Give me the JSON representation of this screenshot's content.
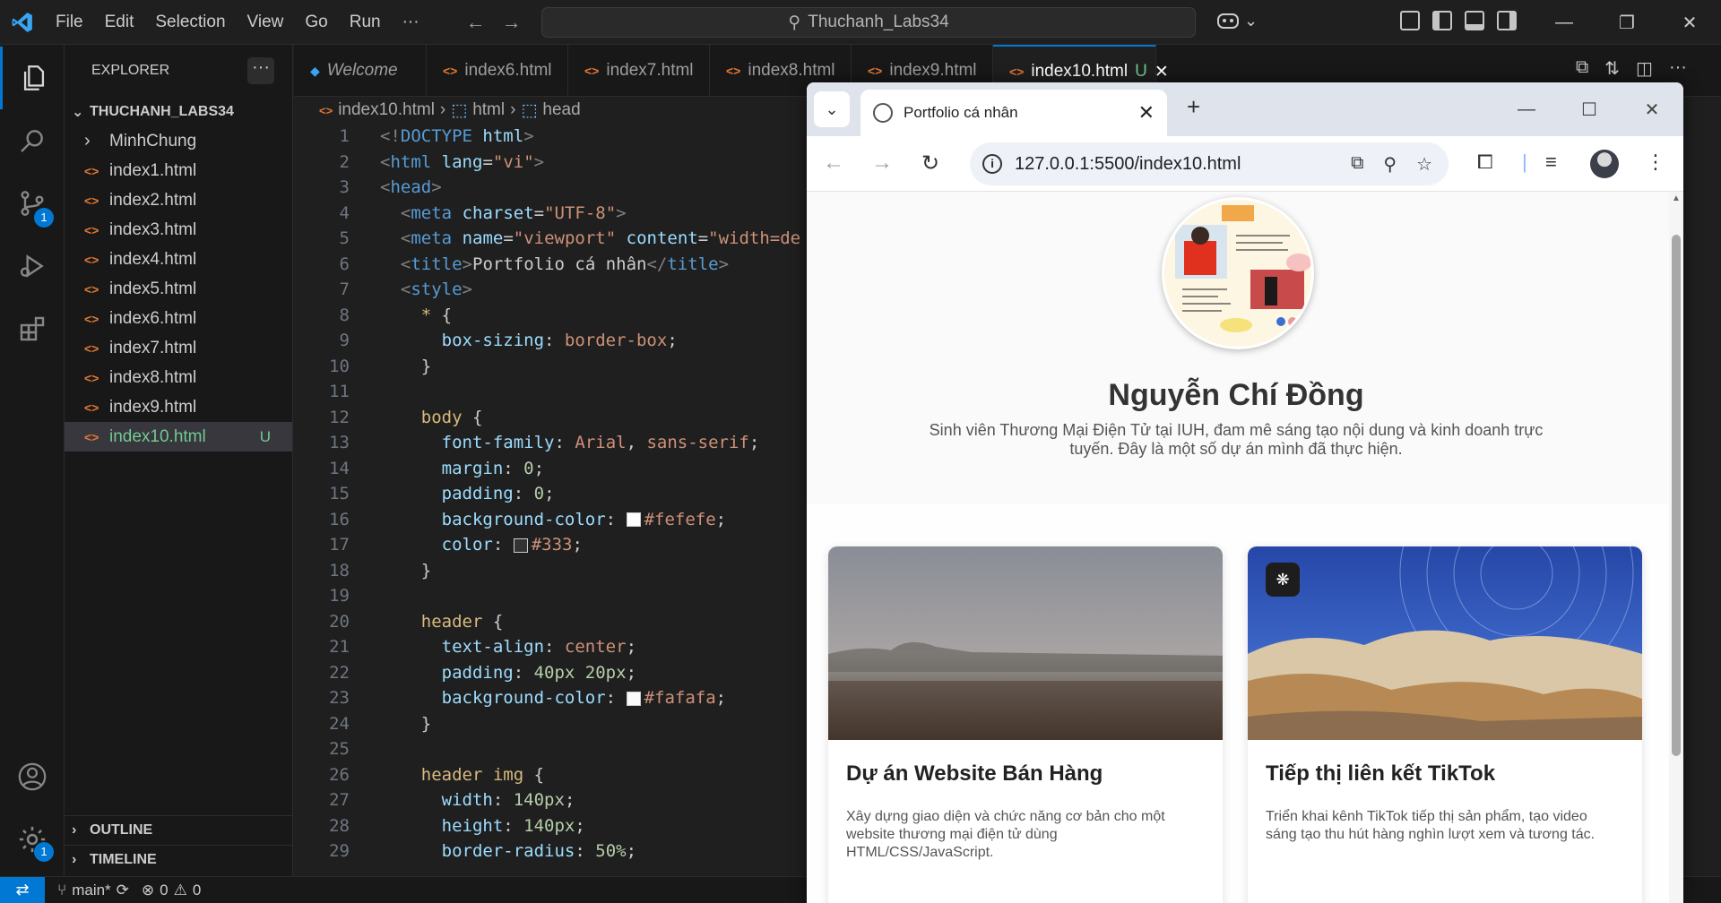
{
  "menu": [
    "File",
    "Edit",
    "Selection",
    "View",
    "Go",
    "Run",
    "···"
  ],
  "command_center": "Thuchanh_Labs34",
  "explorer": {
    "title": "EXPLORER",
    "folder": "THUCHANH_LABS34",
    "items": [
      {
        "label": "MinhChung",
        "type": "folder",
        "icon": "chevron-right-icon"
      },
      {
        "label": "index1.html",
        "type": "html"
      },
      {
        "label": "index2.html",
        "type": "html"
      },
      {
        "label": "index3.html",
        "type": "html"
      },
      {
        "label": "index4.html",
        "type": "html"
      },
      {
        "label": "index5.html",
        "type": "html"
      },
      {
        "label": "index6.html",
        "type": "html"
      },
      {
        "label": "index7.html",
        "type": "html"
      },
      {
        "label": "index8.html",
        "type": "html"
      },
      {
        "label": "index9.html",
        "type": "html"
      },
      {
        "label": "index10.html",
        "type": "html",
        "status": "U",
        "selected": true
      }
    ],
    "outline": "OUTLINE",
    "timeline": "TIMELINE"
  },
  "activity_badges": {
    "source_control": "1",
    "settings": "1"
  },
  "tabs": [
    {
      "label": "Welcome",
      "kind": "welcome"
    },
    {
      "label": "index6.html"
    },
    {
      "label": "index7.html"
    },
    {
      "label": "index8.html"
    },
    {
      "label": "index9.html"
    },
    {
      "label": "index10.html",
      "status": "U",
      "active": true
    }
  ],
  "breadcrumb": [
    "index10.html",
    "html",
    "head"
  ],
  "code_lines": [
    {
      "n": "1",
      "tokens": [
        [
          "tag",
          "<!"
        ],
        [
          "name",
          "DOCTYPE"
        ],
        [
          "txt",
          " "
        ],
        [
          "attr",
          "html"
        ],
        [
          "tag",
          ">"
        ]
      ]
    },
    {
      "n": "2",
      "tokens": [
        [
          "tag",
          "<"
        ],
        [
          "name",
          "html"
        ],
        [
          "txt",
          " "
        ],
        [
          "attr",
          "lang"
        ],
        [
          "txt",
          "="
        ],
        [
          "str",
          "\"vi\""
        ],
        [
          "tag",
          ">"
        ]
      ]
    },
    {
      "n": "3",
      "tokens": [
        [
          "tag",
          "<"
        ],
        [
          "name",
          "head"
        ],
        [
          "tag",
          ">"
        ]
      ]
    },
    {
      "n": "4",
      "tokens": [
        [
          "txt",
          "  "
        ],
        [
          "tag",
          "<"
        ],
        [
          "name",
          "meta"
        ],
        [
          "txt",
          " "
        ],
        [
          "attr",
          "charset"
        ],
        [
          "txt",
          "="
        ],
        [
          "str",
          "\"UTF-8\""
        ],
        [
          "tag",
          ">"
        ]
      ]
    },
    {
      "n": "5",
      "tokens": [
        [
          "txt",
          "  "
        ],
        [
          "tag",
          "<"
        ],
        [
          "name",
          "meta"
        ],
        [
          "txt",
          " "
        ],
        [
          "attr",
          "name"
        ],
        [
          "txt",
          "="
        ],
        [
          "str",
          "\"viewport\""
        ],
        [
          "txt",
          " "
        ],
        [
          "attr",
          "content"
        ],
        [
          "txt",
          "="
        ],
        [
          "str",
          "\"width=de"
        ]
      ]
    },
    {
      "n": "6",
      "tokens": [
        [
          "txt",
          "  "
        ],
        [
          "tag",
          "<"
        ],
        [
          "name",
          "title"
        ],
        [
          "tag",
          ">"
        ],
        [
          "txt",
          "Portfolio cá nhân"
        ],
        [
          "tag",
          "</"
        ],
        [
          "name",
          "title"
        ],
        [
          "tag",
          ">"
        ]
      ]
    },
    {
      "n": "7",
      "tokens": [
        [
          "txt",
          "  "
        ],
        [
          "tag",
          "<"
        ],
        [
          "name",
          "style"
        ],
        [
          "tag",
          ">"
        ]
      ]
    },
    {
      "n": "8",
      "tokens": [
        [
          "txt",
          "    "
        ],
        [
          "sel",
          "*"
        ],
        [
          "txt",
          " {"
        ]
      ]
    },
    {
      "n": "9",
      "tokens": [
        [
          "txt",
          "      "
        ],
        [
          "prop",
          "box-sizing"
        ],
        [
          "txt",
          ": "
        ],
        [
          "val",
          "border-box"
        ],
        [
          "txt",
          ";"
        ]
      ]
    },
    {
      "n": "10",
      "tokens": [
        [
          "txt",
          "    }"
        ]
      ]
    },
    {
      "n": "11",
      "tokens": [
        [
          "txt",
          ""
        ]
      ]
    },
    {
      "n": "12",
      "tokens": [
        [
          "txt",
          "    "
        ],
        [
          "sel",
          "body"
        ],
        [
          "txt",
          " {"
        ]
      ]
    },
    {
      "n": "13",
      "tokens": [
        [
          "txt",
          "      "
        ],
        [
          "prop",
          "font-family"
        ],
        [
          "txt",
          ": "
        ],
        [
          "val",
          "Arial"
        ],
        [
          "txt",
          ", "
        ],
        [
          "val",
          "sans-serif"
        ],
        [
          "txt",
          ";"
        ]
      ]
    },
    {
      "n": "14",
      "tokens": [
        [
          "txt",
          "      "
        ],
        [
          "prop",
          "margin"
        ],
        [
          "txt",
          ": "
        ],
        [
          "num",
          "0"
        ],
        [
          "txt",
          ";"
        ]
      ]
    },
    {
      "n": "15",
      "tokens": [
        [
          "txt",
          "      "
        ],
        [
          "prop",
          "padding"
        ],
        [
          "txt",
          ": "
        ],
        [
          "num",
          "0"
        ],
        [
          "txt",
          ";"
        ]
      ]
    },
    {
      "n": "16",
      "tokens": [
        [
          "txt",
          "      "
        ],
        [
          "prop",
          "background-color"
        ],
        [
          "txt",
          ": "
        ],
        [
          "swatch",
          "#fefefe"
        ],
        [
          "val",
          "#fefefe"
        ],
        [
          "txt",
          ";"
        ]
      ]
    },
    {
      "n": "17",
      "tokens": [
        [
          "txt",
          "      "
        ],
        [
          "prop",
          "color"
        ],
        [
          "txt",
          ": "
        ],
        [
          "swatch",
          "#333333"
        ],
        [
          "val",
          "#333"
        ],
        [
          "txt",
          ";"
        ]
      ]
    },
    {
      "n": "18",
      "tokens": [
        [
          "txt",
          "    }"
        ]
      ]
    },
    {
      "n": "19",
      "tokens": [
        [
          "txt",
          ""
        ]
      ]
    },
    {
      "n": "20",
      "tokens": [
        [
          "txt",
          "    "
        ],
        [
          "sel",
          "header"
        ],
        [
          "txt",
          " {"
        ]
      ]
    },
    {
      "n": "21",
      "tokens": [
        [
          "txt",
          "      "
        ],
        [
          "prop",
          "text-align"
        ],
        [
          "txt",
          ": "
        ],
        [
          "val",
          "center"
        ],
        [
          "txt",
          ";"
        ]
      ]
    },
    {
      "n": "22",
      "tokens": [
        [
          "txt",
          "      "
        ],
        [
          "prop",
          "padding"
        ],
        [
          "txt",
          ": "
        ],
        [
          "num",
          "40px 20px"
        ],
        [
          "txt",
          ";"
        ]
      ]
    },
    {
      "n": "23",
      "tokens": [
        [
          "txt",
          "      "
        ],
        [
          "prop",
          "background-color"
        ],
        [
          "txt",
          ": "
        ],
        [
          "swatch",
          "#fafafa"
        ],
        [
          "val",
          "#fafafa"
        ],
        [
          "txt",
          ";"
        ]
      ]
    },
    {
      "n": "24",
      "tokens": [
        [
          "txt",
          "    }"
        ]
      ]
    },
    {
      "n": "25",
      "tokens": [
        [
          "txt",
          ""
        ]
      ]
    },
    {
      "n": "26",
      "tokens": [
        [
          "txt",
          "    "
        ],
        [
          "sel",
          "header img"
        ],
        [
          "txt",
          " {"
        ]
      ]
    },
    {
      "n": "27",
      "tokens": [
        [
          "txt",
          "      "
        ],
        [
          "prop",
          "width"
        ],
        [
          "txt",
          ": "
        ],
        [
          "num",
          "140px"
        ],
        [
          "txt",
          ";"
        ]
      ]
    },
    {
      "n": "28",
      "tokens": [
        [
          "txt",
          "      "
        ],
        [
          "prop",
          "height"
        ],
        [
          "txt",
          ": "
        ],
        [
          "num",
          "140px"
        ],
        [
          "txt",
          ";"
        ]
      ]
    },
    {
      "n": "29",
      "tokens": [
        [
          "txt",
          "      "
        ],
        [
          "prop",
          "border-radius"
        ],
        [
          "txt",
          ": "
        ],
        [
          "num",
          "50%"
        ],
        [
          "txt",
          ";"
        ]
      ]
    }
  ],
  "status_bar": {
    "branch": "main*",
    "errors": "0",
    "warnings": "0"
  },
  "browser": {
    "tab_title": "Portfolio cá nhân",
    "url": "127.0.0.1:5500/index10.html",
    "page": {
      "name": "Nguyễn Chí Đồng",
      "intro": "Sinh viên Thương Mại Điện Tử tại IUH, đam mê sáng tạo nội dung và kinh doanh trực tuyến. Đây là một số dự án mình đã thực hiện.",
      "cards": [
        {
          "title": "Dự án Website Bán Hàng",
          "desc": "Xây dựng giao diện và chức năng cơ bản cho một website thương mại điện tử dùng HTML/CSS/JavaScript."
        },
        {
          "title": "Tiếp thị liên kết TikTok",
          "desc": "Triển khai kênh TikTok tiếp thị sản phẩm, tạo video sáng tạo thu hút hàng nghìn lượt xem và tương tác."
        }
      ]
    }
  },
  "colors": {
    "accent": "#0078d4",
    "untracked": "#73c991",
    "html_icon": "#e37933"
  }
}
